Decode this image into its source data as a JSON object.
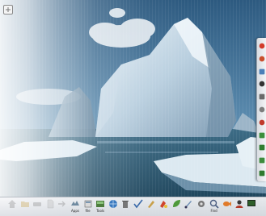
{
  "desktop": {
    "wallpaper_subject": "iceberg in arctic sea",
    "sky_color": "#3f6d92",
    "water_color": "#1f4a63"
  },
  "panel": {
    "launchers": [
      {
        "name": "home-launcher",
        "label": "",
        "icon": "home-icon",
        "faded": true
      },
      {
        "name": "launcher-2",
        "label": "",
        "icon": "folder-icon",
        "faded": true
      },
      {
        "name": "launcher-3",
        "label": "",
        "icon": "drive-icon",
        "faded": true
      },
      {
        "name": "launcher-4",
        "label": "",
        "icon": "document-icon",
        "faded": true
      },
      {
        "name": "launcher-5",
        "label": "",
        "icon": "arrow-icon",
        "faded": true
      },
      {
        "name": "apps-launcher",
        "label": "Apps",
        "icon": "apps-icon",
        "faded": false
      },
      {
        "name": "file-launcher",
        "label": "file",
        "icon": "file-icon",
        "faded": false
      },
      {
        "name": "tools-launcher",
        "label": "Tools",
        "icon": "tools-icon",
        "faded": false
      },
      {
        "name": "browser-launcher",
        "label": "",
        "icon": "browser-icon",
        "faded": false
      },
      {
        "name": "trash-launcher",
        "label": "",
        "icon": "trash-icon",
        "faded": false
      },
      {
        "name": "check-launcher",
        "label": "",
        "icon": "checkmark-icon",
        "faded": false
      },
      {
        "name": "edit-launcher",
        "label": "",
        "icon": "pencil-icon",
        "faded": false
      },
      {
        "name": "paint-launcher",
        "label": "",
        "icon": "paint-icon",
        "faded": false
      },
      {
        "name": "tree-launcher",
        "label": "",
        "icon": "leaf-icon",
        "faded": false
      },
      {
        "name": "draw-launcher",
        "label": "",
        "icon": "brush-icon",
        "faded": false
      },
      {
        "name": "settings-launcher",
        "label": "",
        "icon": "gear-icon",
        "faded": false
      },
      {
        "name": "find-launcher",
        "label": "Find",
        "icon": "magnifier-icon",
        "faded": false
      },
      {
        "name": "fish-launcher",
        "label": "",
        "icon": "fish-icon",
        "faded": false
      },
      {
        "name": "users-launcher",
        "label": "",
        "icon": "user-icon",
        "faded": false
      },
      {
        "name": "monitor-launcher",
        "label": "",
        "icon": "monitor-icon",
        "faded": false
      }
    ]
  },
  "side_dock": {
    "items": [
      {
        "name": "dock-item-1",
        "icon": "circle-icon",
        "color": "#d23b2a"
      },
      {
        "name": "dock-item-2",
        "icon": "circle-icon",
        "color": "#c94f2c"
      },
      {
        "name": "dock-item-3",
        "icon": "square-icon",
        "color": "#4a7fb8"
      },
      {
        "name": "dock-item-4",
        "icon": "circle-icon",
        "color": "#333333"
      },
      {
        "name": "dock-item-5",
        "icon": "square-icon",
        "color": "#6a6a6a"
      },
      {
        "name": "dock-item-6",
        "icon": "circle-icon",
        "color": "#7d7d7d"
      },
      {
        "name": "dock-item-7",
        "icon": "circle-icon",
        "color": "#c03a2b"
      },
      {
        "name": "dock-item-8",
        "icon": "square-icon",
        "color": "#3c8f3c"
      },
      {
        "name": "dock-item-9",
        "icon": "square-icon",
        "color": "#2f7d2f"
      },
      {
        "name": "dock-item-10",
        "icon": "square-icon",
        "color": "#3d8b3d"
      },
      {
        "name": "dock-item-11",
        "icon": "square-icon",
        "color": "#2e7a2e"
      }
    ]
  }
}
